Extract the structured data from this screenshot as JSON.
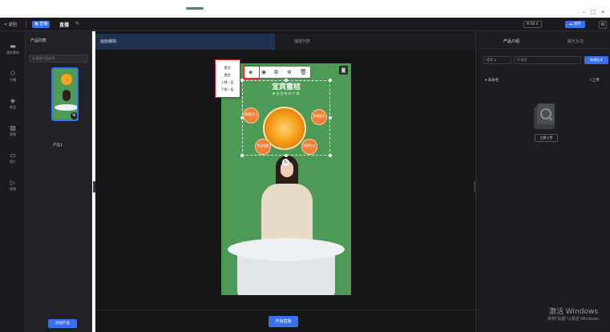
{
  "topbar": {
    "back": "< 返回",
    "live_tag": "直播",
    "title": "直播",
    "ratio": "9:16 ∨",
    "save": "保存"
  },
  "rail": {
    "items": [
      "我的素材",
      "主播",
      "商品",
      "背景",
      "图片",
      "视频"
    ]
  },
  "product_list": {
    "title": "产品列表",
    "search_placeholder": "Q 搜索产品名称",
    "item_name": "产品1",
    "add_button": "添加产品"
  },
  "tabs": {
    "edit": "画面编辑",
    "play": "播放列表"
  },
  "canvas": {
    "title": "宜宾蜜桔",
    "subtitle": "来自宜宾好产地",
    "bubbles": [
      "鲜甜多汁",
      "现摘现发",
      "果皮细嫩",
      "香甜可口"
    ]
  },
  "layer_menu": {
    "items": [
      "置顶",
      "置底",
      "上移一层",
      "下移一层"
    ]
  },
  "center": {
    "start_button": "开始直播"
  },
  "right_panel": {
    "tab_intro": "产品介绍",
    "tab_interact": "聊天互动",
    "dropdown": "话术 ∨",
    "search_placeholder": "Q 搜索",
    "new_button": "新增话术",
    "category": "▾ 未命名",
    "upload": "上传",
    "upload_button": "立即上传"
  },
  "watermark": {
    "line1": "激活 Windows",
    "line2": "转到\"设置\"以激活 Windows。"
  },
  "colors": {
    "accent": "#3a6ff0",
    "highlight": "#e0201c",
    "canvas_bg": "#4c9a55"
  }
}
